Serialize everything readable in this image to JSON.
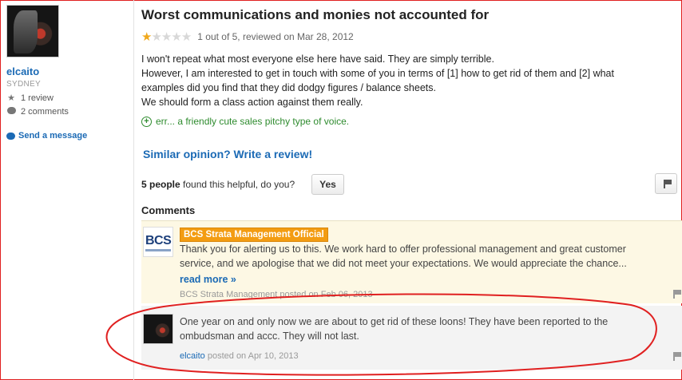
{
  "user": {
    "name": "elcaito",
    "location": "SYDNEY",
    "reviews": "1 review",
    "comments": "2 comments",
    "send_message": "Send a message"
  },
  "review": {
    "title": "Worst communications and monies not accounted for",
    "rating": 1,
    "rating_max": 5,
    "rating_text": "1 out of 5, reviewed on Mar 28, 2012",
    "body": [
      "I won't repeat what most everyone else here have said. They are simply terrible.",
      "However, I am interested to get in touch with some of you in terms of [1] how to get rid of them and [2] what examples did you find that they did dodgy figures / balance sheets.",
      "We should form a class action against them really."
    ],
    "expand_text": "err... a friendly cute sales pitchy type of voice.",
    "similar_link": "Similar opinion? Write a review!",
    "helpful_count": "5 people",
    "helpful_question": "found this helpful, do you?",
    "yes_label": "Yes"
  },
  "comments": {
    "heading": "Comments",
    "items": [
      {
        "avatar_text": "BCS",
        "badge": "BCS Strata Management Official",
        "text": "Thank you for alerting us to this. We work hard to offer professional management and great customer service, and we apologise that we did not meet your expectations. We would appreciate the chance...",
        "read_more": "read more »",
        "author": "BCS Strata Management",
        "posted": "posted on Feb 06, 2013"
      },
      {
        "text": "One year on and only now we are about to get rid of these loons! They have been reported to the ombudsman and accc. They will not last.",
        "author": "elcaito",
        "posted": "posted on Apr 10, 2013"
      }
    ]
  },
  "colors": {
    "link": "#1b6ab5",
    "badge": "#f39c12",
    "annotation": "#e02020"
  }
}
